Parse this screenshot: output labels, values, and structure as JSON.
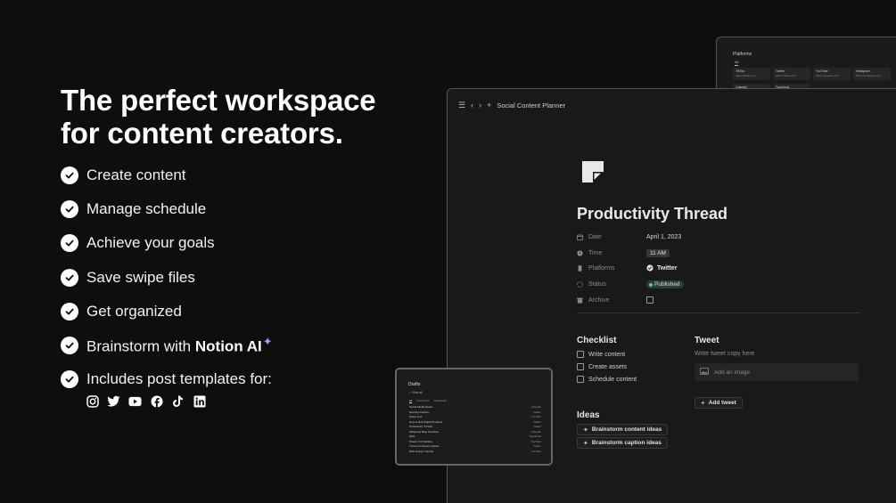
{
  "headline": {
    "line1": "The perfect workspace",
    "line2": "for content creators."
  },
  "features": [
    {
      "text": "Create content"
    },
    {
      "text": "Manage schedule"
    },
    {
      "text": "Achieve your goals"
    },
    {
      "text": "Save swipe files"
    },
    {
      "text": "Get organized"
    },
    {
      "text": "Brainstorm with ",
      "bold": "Notion AI"
    },
    {
      "text": "Includes post templates for:"
    }
  ],
  "social_icons": [
    "instagram-icon",
    "twitter-icon",
    "youtube-icon",
    "facebook-icon",
    "tiktok-icon",
    "linkedin-icon"
  ],
  "main_window": {
    "breadcrumb": "Social Content Planner",
    "page_title": "Productivity Thread",
    "properties": {
      "date": {
        "label": "Date",
        "value": "April 1, 2023"
      },
      "time": {
        "label": "Time",
        "value": "11 AM"
      },
      "platforms": {
        "label": "Platforms",
        "value": "Twitter"
      },
      "status": {
        "label": "Status",
        "value": "Published"
      },
      "archive": {
        "label": "Archive",
        "checked": false
      }
    },
    "checklist": {
      "title": "Checklist",
      "items": [
        "Write content",
        "Create assets",
        "Schedule content"
      ]
    },
    "tweet": {
      "title": "Tweet",
      "placeholder": "Write tweet copy here",
      "add_image": "Add an image",
      "add_button": "Add tweet"
    },
    "ideas": {
      "title": "Ideas",
      "buttons": [
        "Brainstorm content ideas",
        "Brainstorm caption ideas"
      ]
    }
  },
  "platforms_window": {
    "title": "Platforms",
    "tab": "All",
    "cards": [
      {
        "name": "TikTok",
        "url": "https://tiktok.com"
      },
      {
        "name": "Twitter",
        "url": "https://twitter.com"
      },
      {
        "name": "YouTube",
        "url": "https://youtube.com"
      },
      {
        "name": "Instagram",
        "url": "https://instagram.com"
      },
      {
        "name": "LinkedIn",
        "url": ""
      },
      {
        "name": "Facebook",
        "url": ""
      }
    ]
  },
  "drafts_window": {
    "title": "Drafts",
    "search": "View all",
    "tabs": [
      "All",
      "Social Icon",
      "Newsletter"
    ],
    "rows": [
      {
        "name": "Social Media Hacks",
        "platform": "LinkedIn"
      },
      {
        "name": "Morning Routine",
        "platform": "Twitter"
      },
      {
        "name": "Setup Tour",
        "platform": "YouTube"
      },
      {
        "name": "How to Sell Digital Products",
        "platform": "Twitter"
      },
      {
        "name": "Productivity Thread",
        "platform": "Twitter"
      },
      {
        "name": "Marketing Blog Favorites",
        "platform": "LinkedIn"
      },
      {
        "name": "Q&A",
        "platform": "Facebook"
      },
      {
        "name": "Stream Compilation",
        "platform": "YouTube"
      },
      {
        "name": "Thread of Recent Articles",
        "platform": "Twitter"
      },
      {
        "name": "Web Design Tutorial",
        "platform": "YouTube"
      }
    ]
  },
  "colors": {
    "background": "#0e0e0e",
    "window": "#191919",
    "ai_accent": "#c58cff",
    "status_green": "#6fbf73"
  }
}
